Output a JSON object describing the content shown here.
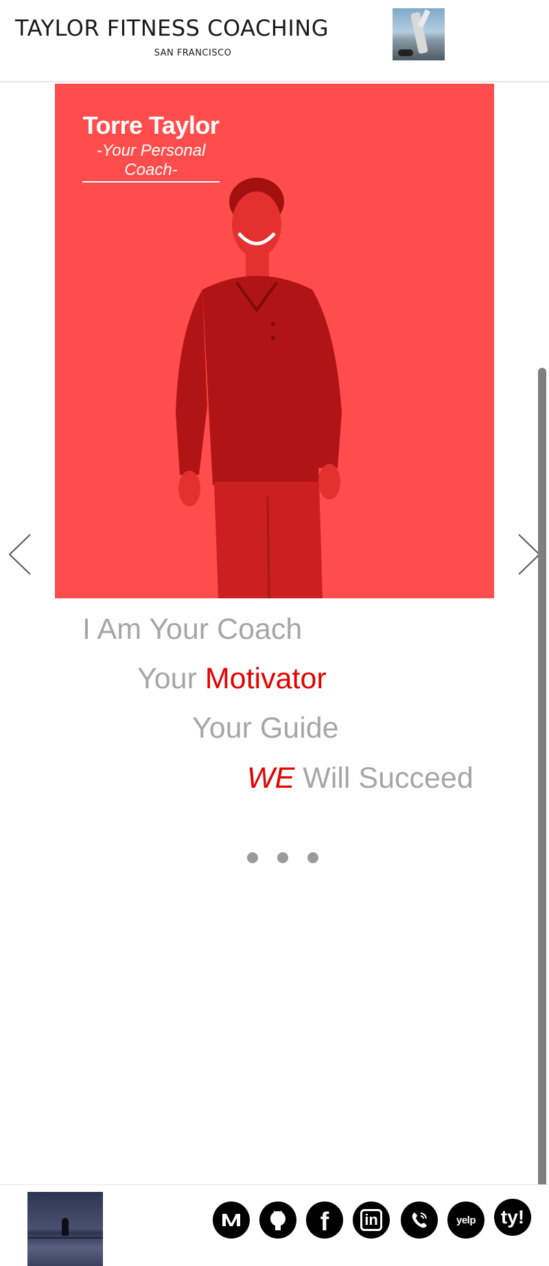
{
  "header": {
    "title": "TAYLOR FITNESS COACHING",
    "subtitle": "SAN FRANCISCO"
  },
  "hero": {
    "name": "Torre Taylor",
    "tagline_line1": "-Your Personal",
    "tagline_line2": "Coach-",
    "overlay_color": "#ff4c4c"
  },
  "slogans": {
    "line1": "I Am Your Coach",
    "line2_prefix": "Your ",
    "line2_highlight": "Motivator",
    "line3": "Your Guide",
    "line4_highlight": "WE",
    "line4_suffix": " Will Succeed",
    "accent_color": "#e60000",
    "text_color": "#a6a6a6"
  },
  "carousel": {
    "slide_count": 3
  },
  "social": {
    "items": [
      {
        "name": "medium-icon"
      },
      {
        "name": "github-icon"
      },
      {
        "name": "facebook-icon",
        "glyph": "f"
      },
      {
        "name": "linkedin-icon",
        "glyph": "in"
      },
      {
        "name": "phone-icon"
      },
      {
        "name": "yelp-icon",
        "glyph": "yelp"
      },
      {
        "name": "ty-icon",
        "glyph": "ty!"
      }
    ]
  }
}
